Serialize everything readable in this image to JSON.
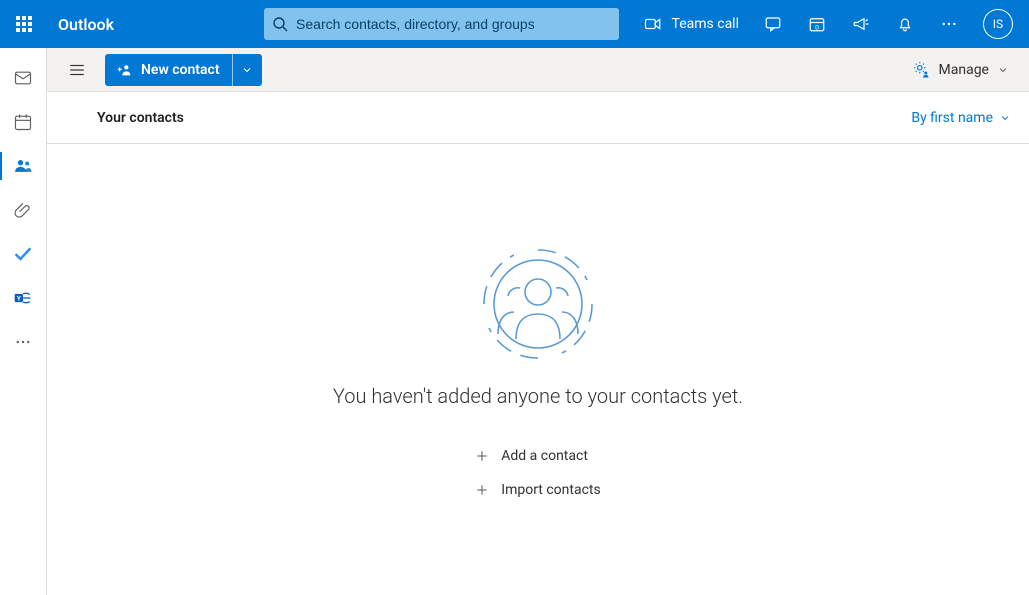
{
  "header": {
    "brand": "Outlook",
    "search_placeholder": "Search contacts, directory, and groups",
    "teams_call_label": "Teams call",
    "avatar_initials": "IS"
  },
  "toolbar": {
    "new_contact_label": "New contact",
    "manage_label": "Manage"
  },
  "content": {
    "title": "Your contacts",
    "sort_label": "By first name"
  },
  "empty_state": {
    "message": "You haven't added anyone to your contacts yet.",
    "add_contact_label": "Add a contact",
    "import_contacts_label": "Import contacts"
  }
}
